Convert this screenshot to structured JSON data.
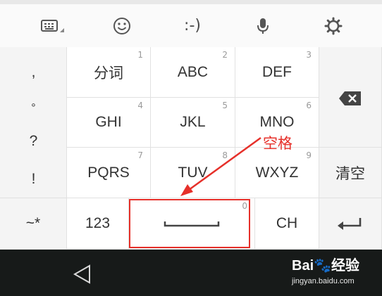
{
  "toolbar": {
    "emoticon": ":-)",
    "icons": [
      "keyboard-icon",
      "emoji-icon",
      "emoticon",
      "microphone-icon",
      "settings-icon"
    ]
  },
  "symbols": [
    ",",
    "°",
    "?",
    "!"
  ],
  "keys": {
    "row1": [
      {
        "main": "分词",
        "num": "1"
      },
      {
        "main": "ABC",
        "num": "2"
      },
      {
        "main": "DEF",
        "num": "3"
      }
    ],
    "row2": [
      {
        "main": "GHI",
        "num": "4"
      },
      {
        "main": "JKL",
        "num": "5"
      },
      {
        "main": "MNO",
        "num": "6"
      }
    ],
    "row3": [
      {
        "main": "PQRS",
        "num": "7"
      },
      {
        "main": "TUV",
        "num": "8"
      },
      {
        "main": "WXYZ",
        "num": "9"
      }
    ],
    "clear": "清空",
    "symbols_key": "~*",
    "num_mode": "123",
    "space_num": "0",
    "ch_mode": "CH"
  },
  "annotation": {
    "label": "空格",
    "color": "#e6302a"
  },
  "watermark": {
    "title": "Bai🐾经验",
    "url": "jingyan.baidu.com"
  }
}
